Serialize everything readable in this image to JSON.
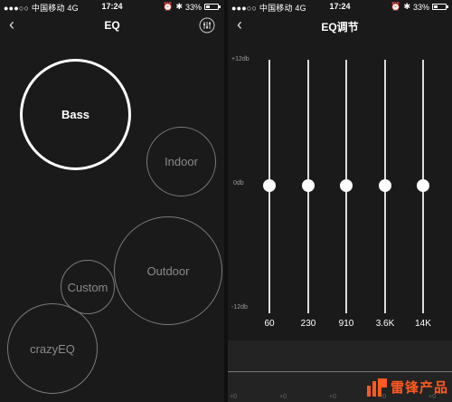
{
  "status": {
    "carrier": "●●●○○ 中国移动  4G",
    "time": "17:24",
    "battery": "33%",
    "battery_level": 0.33
  },
  "left": {
    "title": "EQ",
    "presets": [
      {
        "label": "Bass",
        "active": true
      },
      {
        "label": "Indoor",
        "active": false
      },
      {
        "label": "Outdoor",
        "active": false
      },
      {
        "label": "Custom",
        "active": false
      },
      {
        "label": "crazyEQ",
        "active": false
      }
    ]
  },
  "right": {
    "title": "EQ调节",
    "scale": {
      "max": "+12db",
      "mid": "0db",
      "min": "-12db"
    },
    "bands": [
      {
        "freq": "60",
        "gain_db": 0
      },
      {
        "freq": "230",
        "gain_db": 0
      },
      {
        "freq": "910",
        "gain_db": 0
      },
      {
        "freq": "3.6K",
        "gain_db": 0
      },
      {
        "freq": "14K",
        "gain_db": 0
      }
    ],
    "graph_ticks": [
      "+0",
      "+0",
      "+0",
      "+0",
      "+0"
    ]
  },
  "watermark": {
    "text": "雷锋产品",
    "color": "#ff5a1f"
  }
}
